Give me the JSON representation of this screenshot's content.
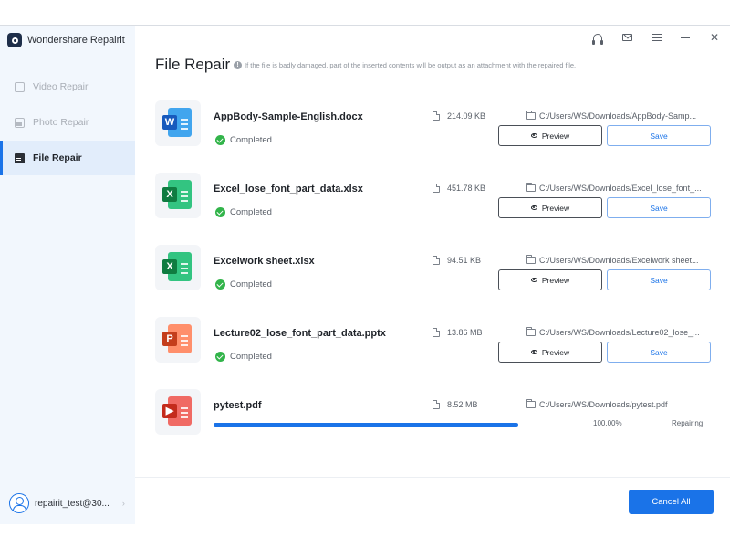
{
  "app": {
    "name": "Wondershare Repairit"
  },
  "sidebar": {
    "items": [
      {
        "label": "Video Repair",
        "icon": "video-icon",
        "active": false
      },
      {
        "label": "Photo Repair",
        "icon": "photo-icon",
        "active": false
      },
      {
        "label": "File Repair",
        "icon": "file-icon",
        "active": true
      }
    ],
    "account": "repairit_test@30..."
  },
  "header": {
    "title": "File Repair",
    "hint": "If the file is badly damaged, part of the inserted contents will be output as an attachment with the repaired file."
  },
  "files": [
    {
      "name": "AppBody-Sample-English.docx",
      "type": "word",
      "status": "Completed",
      "size": "214.09 KB",
      "path": "C:/Users/WS/Downloads/AppBody-Samp..."
    },
    {
      "name": "Excel_lose_font_part_data.xlsx",
      "type": "excel",
      "status": "Completed",
      "size": "451.78 KB",
      "path": "C:/Users/WS/Downloads/Excel_lose_font_..."
    },
    {
      "name": "Excelwork sheet.xlsx",
      "type": "excel",
      "status": "Completed",
      "size": "94.51 KB",
      "path": "C:/Users/WS/Downloads/Excelwork sheet..."
    },
    {
      "name": "Lecture02_lose_font_part_data.pptx",
      "type": "powerpoint",
      "status": "Completed",
      "size": "13.86 MB",
      "path": "C:/Users/WS/Downloads/Lecture02_lose_..."
    },
    {
      "name": "pytest.pdf",
      "type": "pdf",
      "status": "Repairing",
      "size": "8.52 MB",
      "path": "C:/Users/WS/Downloads/pytest.pdf",
      "progress_label": "100.00%",
      "progress": 1.0
    }
  ],
  "buttons": {
    "preview": "Preview",
    "save": "Save",
    "cancel_all": "Cancel All"
  },
  "colors": {
    "accent": "#1a73e8",
    "success": "#32b44a",
    "word": "#2b7cd3",
    "excel": "#21a366",
    "powerpoint": "#e8672c",
    "pdf": "#e0443e"
  }
}
